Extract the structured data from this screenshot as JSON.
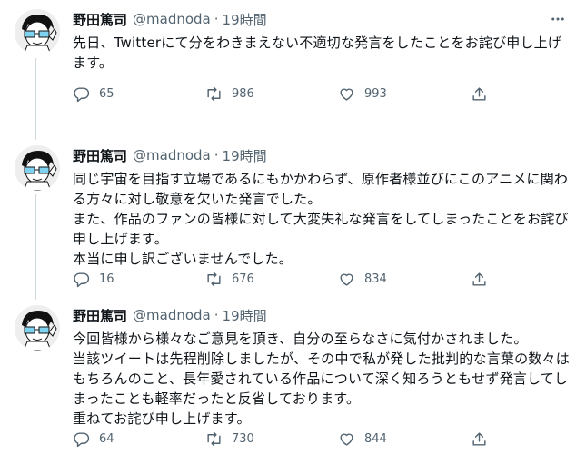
{
  "tweets": [
    {
      "name": "野田篤司",
      "handle": "@madnoda",
      "separator": "·",
      "time": "19時間",
      "text": "先日、Twitterにて分をわきまえない不適切な発言をしたことをお詫び申し上げます。",
      "replies": "65",
      "retweets": "986",
      "likes": "993"
    },
    {
      "name": "野田篤司",
      "handle": "@madnoda",
      "separator": "·",
      "time": "19時間",
      "text": "同じ宇宙を目指す立場であるにもかかわらず、原作者様並びにこのアニメに関わる方々に対し敬意を欠いた発言でした。\nまた、作品のファンの皆様に対して大変失礼な発言をしてしまったことをお詫び申し上げます。\n本当に申し訳ございませんでした。",
      "replies": "16",
      "retweets": "676",
      "likes": "834"
    },
    {
      "name": "野田篤司",
      "handle": "@madnoda",
      "separator": "·",
      "time": "19時間",
      "text": "今回皆様から様々なご意見を頂き、自分の至らなさに気付かされました。\n当該ツイートは先程削除しましたが、その中で私が発した批判的な言葉の数々はもちろんのこと、長年愛されている作品について深く知ろうともせず発言してしまったことも軽率だったと反省しております。\n重ねてお詫び申し上げます。",
      "replies": "64",
      "retweets": "730",
      "likes": "844"
    }
  ],
  "icons": {
    "reply": "reply-icon",
    "retweet": "retweet-icon",
    "like": "like-icon",
    "share": "share-icon",
    "more": "more-icon"
  },
  "colors": {
    "text": "#0f1419",
    "secondary": "#536471",
    "thread_line": "#cfd9de"
  }
}
